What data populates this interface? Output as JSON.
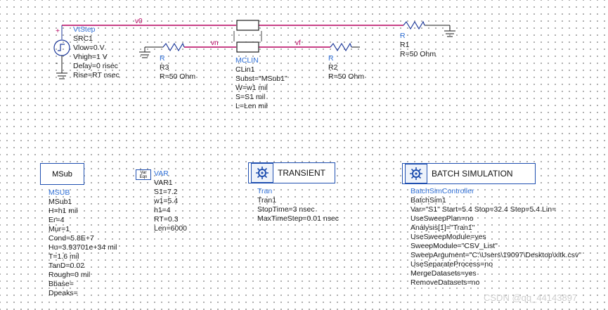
{
  "schematic": {
    "wire_labels": {
      "v0": "v0",
      "vn": "vn",
      "vf": "vf"
    },
    "src": {
      "type": "VtStep",
      "name": "SRC1",
      "params": [
        "Vlow=0 V",
        "Vhigh=1 V",
        "Delay=0 nsec",
        "Rise=RT nsec"
      ],
      "plus": "+",
      "minus": "-"
    },
    "r1": {
      "type": "R",
      "name": "R1",
      "params": [
        "R=50 Ohm"
      ]
    },
    "r3": {
      "type": "R",
      "name": "R3",
      "params": [
        "R=50 Ohm"
      ]
    },
    "r2": {
      "type": "R",
      "name": "R2",
      "params": [
        "R=50 Ohm"
      ]
    },
    "mclin": {
      "type": "MCLIN",
      "name": "CLin1",
      "params": [
        "Subst=\"MSub1\"",
        "W=w1 mil",
        "S=S1 mil",
        "L=Len mil"
      ]
    },
    "msub": {
      "box_label": "MSub",
      "type": "MSUB",
      "name": "MSub1",
      "params": [
        "H=h1 mil",
        "Er=4",
        "Mur=1",
        "Cond=5.8E+7",
        "Hu=3.93701e+34 mil",
        "T=1.6 mil",
        "TanD=0.02",
        "Rough=0 mil",
        "Bbase=",
        "Dpeaks="
      ]
    },
    "var": {
      "icon_line1": "Var",
      "icon_line2": "Eqn",
      "type": "VAR",
      "name": "VAR1",
      "params": [
        "S1=7.2",
        "w1=5.4",
        "h1=4",
        "RT=0.3",
        "Len=6000"
      ]
    },
    "tran": {
      "box_label": "TRANSIENT",
      "type": "Tran",
      "name": "Tran1",
      "params": [
        "StopTime=3 nsec",
        "MaxTimeStep=0.01 nsec"
      ]
    },
    "batch": {
      "box_label": "BATCH SIMULATION",
      "type": "BatchSimController",
      "name": "BatchSim1",
      "params": [
        "Var=\"S1\" Start=5.4 Stop=32.4 Step=5.4 Lin=",
        "UseSweepPlan=no",
        "Analysis[1]=\"Tran1\"",
        "UseSweepModule=yes",
        "SweepModule=\"CSV_List\"",
        "SweepArgument=\"C:\\Users\\19097\\Desktop\\xltk.csv\"",
        "UseSeparateProcess=no",
        "MergeDatasets=yes",
        "RemoveDatasets=no"
      ]
    }
  },
  "colors": {
    "wire": "#b5005f",
    "component": "#1f3a9a",
    "label_blue": "#2f6fd6",
    "ground": "#1a1a1a"
  },
  "watermark": "CSDN @qq_44143897"
}
